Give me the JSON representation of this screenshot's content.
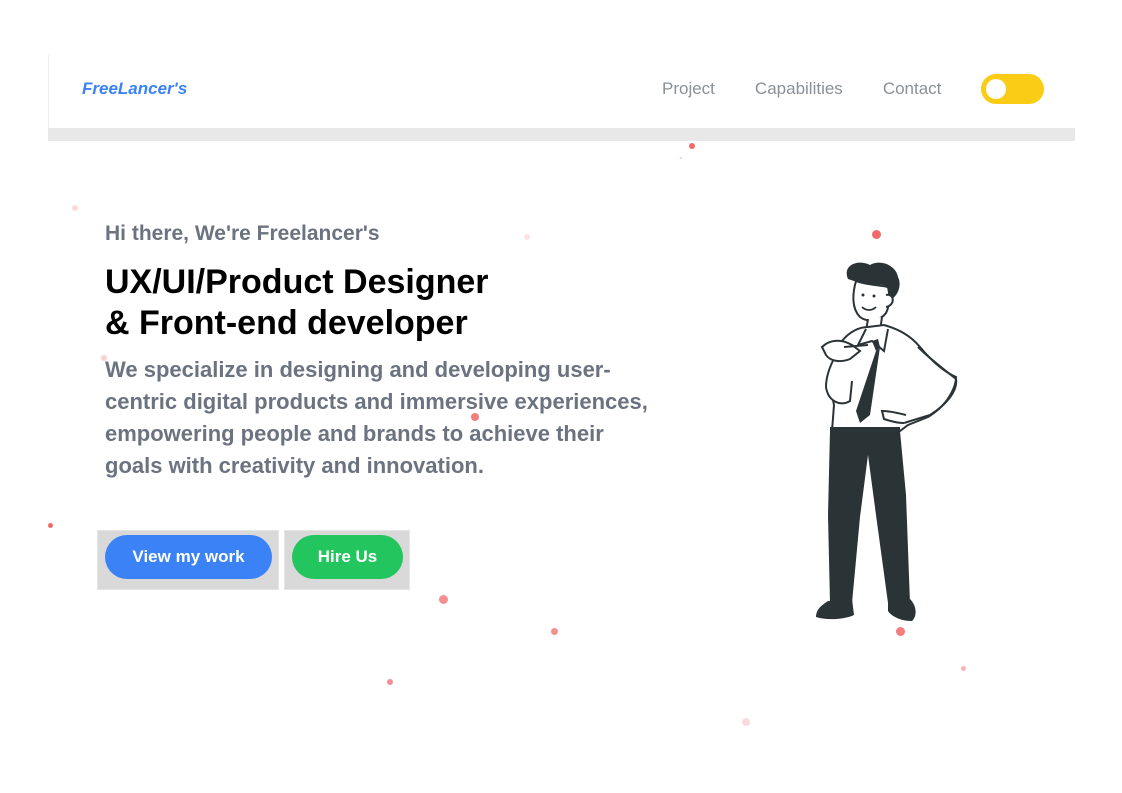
{
  "header": {
    "brand": "FreeLancer's",
    "nav": [
      {
        "label": "Project"
      },
      {
        "label": "Capabilities"
      },
      {
        "label": "Contact"
      }
    ],
    "theme_toggle": {
      "state": "off",
      "color": "#facc15"
    }
  },
  "hero": {
    "intro": "Hi there, We're Freelancer's",
    "headline_line1": "UX/UI/Product Designer",
    "headline_line2": "& Front-end developer",
    "description": "We specialize in designing and developing user-centric digital products and immersive experiences, empowering people and brands to achieve their goals with creativity and innovation.",
    "buttons": {
      "view_work": "View my work",
      "hire": "Hire Us"
    },
    "illustration": "man-pointing-at-self-icon"
  },
  "colors": {
    "brand": "#3b82f6",
    "primary_button": "#3b82f6",
    "secondary_button": "#22c55e",
    "toggle": "#facc15",
    "particles": "#ef4444"
  }
}
